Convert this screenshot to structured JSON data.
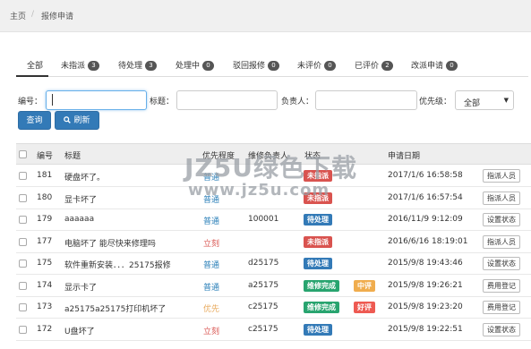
{
  "breadcrumb": {
    "home": "主页",
    "separator": "/",
    "current": "报修申请"
  },
  "tabs": [
    {
      "label": "全部",
      "count": null
    },
    {
      "label": "未指派",
      "count": "3"
    },
    {
      "label": "待处理",
      "count": "3"
    },
    {
      "label": "处理中",
      "count": "0"
    },
    {
      "label": "驳回报修",
      "count": "0"
    },
    {
      "label": "未评价",
      "count": "0"
    },
    {
      "label": "已评价",
      "count": "2"
    },
    {
      "label": "改派申请",
      "count": "0"
    }
  ],
  "filters": {
    "number_label": "编号：",
    "title_label": "标题：",
    "owner_label": "负责人：",
    "priority_label": "优先级：",
    "priority_value": "全部",
    "priority_arrow": "▼"
  },
  "buttons": {
    "query": "查询",
    "refresh": "刷新",
    "refresh_icon": "🔍"
  },
  "table": {
    "headers": {
      "id": "编号",
      "title": "标题",
      "priority": "优先程度",
      "owner": "维修负责人",
      "status": "状态",
      "date": "申请日期"
    },
    "rows": [
      {
        "id": "181",
        "title": "硬盘坏了。",
        "priority": "普通",
        "priority_kind": "normal",
        "owner": "",
        "status": "未指派",
        "status_color": "red",
        "tag": "",
        "date": "2017/1/6 16:58:58",
        "action": "指派人员"
      },
      {
        "id": "180",
        "title": "显卡坏了",
        "priority": "普通",
        "priority_kind": "normal",
        "owner": "",
        "status": "未指派",
        "status_color": "red",
        "tag": "",
        "date": "2017/1/6 16:57:54",
        "action": "指派人员"
      },
      {
        "id": "179",
        "title": "aaaaaa",
        "priority": "普通",
        "priority_kind": "normal",
        "owner": "100001",
        "status": "待处理",
        "status_color": "blue",
        "tag": "",
        "date": "2016/11/9 9:12:09",
        "action": "设置状态"
      },
      {
        "id": "177",
        "title": "电脑坏了 能尽快来修理吗",
        "priority": "立刻",
        "priority_kind": "urgent",
        "owner": "",
        "status": "未指派",
        "status_color": "red",
        "tag": "",
        "date": "2016/6/16 18:19:01",
        "action": "指派人员"
      },
      {
        "id": "175",
        "title": "软件重新安装．．．25175报修",
        "priority": "普通",
        "priority_kind": "normal",
        "owner": "d25175",
        "status": "待处理",
        "status_color": "blue",
        "tag": "",
        "date": "2015/9/8 19:43:46",
        "action": "设置状态"
      },
      {
        "id": "174",
        "title": "显示卡了",
        "priority": "普通",
        "priority_kind": "normal",
        "owner": "a25175",
        "status": "维修完成",
        "status_color": "green",
        "tag": "中评",
        "tag_color": "orange",
        "date": "2015/9/8 19:26:21",
        "action": "费用登记"
      },
      {
        "id": "173",
        "title": "a25175a25175打印机坏了",
        "priority": "优先",
        "priority_kind": "high",
        "owner": "c25175",
        "status": "维修完成",
        "status_color": "green",
        "tag": "好评",
        "tag_color": "pink",
        "date": "2015/9/8 19:23:20",
        "action": "费用登记"
      },
      {
        "id": "172",
        "title": "U盘坏了",
        "priority": "立刻",
        "priority_kind": "urgent",
        "owner": "c25175",
        "status": "待处理",
        "status_color": "blue",
        "tag": "",
        "date": "2015/9/8 19:22:51",
        "action": "设置状态"
      }
    ]
  },
  "watermark": {
    "line1": "JZ5U绿色下载",
    "line2": "www.jz5u.com"
  }
}
